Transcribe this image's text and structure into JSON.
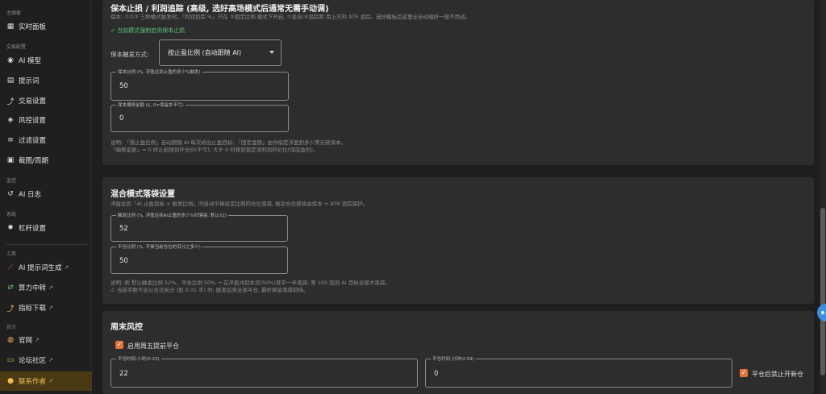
{
  "sidebar": {
    "sections": [
      {
        "label": "主面板"
      },
      {
        "label": "交易配置"
      },
      {
        "label": "监控"
      },
      {
        "label": "系统"
      },
      {
        "label": "工具"
      },
      {
        "label": "官方"
      }
    ],
    "items": [
      {
        "label": "实时面板",
        "icon": "dashboard-icon",
        "glyph": "▦"
      },
      {
        "label": "AI 模型",
        "icon": "brain-icon",
        "glyph": "◉"
      },
      {
        "label": "提示词",
        "icon": "document-icon",
        "glyph": "▤"
      },
      {
        "label": "交易设置",
        "icon": "chart-line-icon",
        "glyph": "⤴"
      },
      {
        "label": "风控设置",
        "icon": "shield-icon",
        "glyph": "◈"
      },
      {
        "label": "过滤设置",
        "icon": "filter-icon",
        "glyph": "≡"
      },
      {
        "label": "截图/周期",
        "icon": "image-icon",
        "glyph": "▣"
      },
      {
        "label": "AI 日志",
        "icon": "history-icon",
        "glyph": "↺"
      },
      {
        "label": "杠杆设置",
        "icon": "gear-icon",
        "glyph": "✹"
      },
      {
        "label": "AI 提示词生成",
        "icon": "magic-wand-icon",
        "glyph": "⟋",
        "external": "↗"
      },
      {
        "label": "算力中转",
        "icon": "exchange-icon",
        "glyph": "⇄",
        "external": "↗"
      },
      {
        "label": "指标下载",
        "icon": "trend-icon",
        "glyph": "⤴",
        "external": "↗"
      },
      {
        "label": "官网",
        "icon": "globe-icon",
        "glyph": "◍",
        "external": "↗"
      },
      {
        "label": "论坛社区",
        "icon": "chat-icon",
        "glyph": "▭",
        "external": "↗"
      },
      {
        "label": "联系作者",
        "icon": "user-icon",
        "glyph": "●",
        "external": "↗"
      }
    ]
  },
  "stoploss": {
    "title": "保本止损 / 利润追踪 (高级, 选好高场模式后通常无需手动调)",
    "desc": "保本: ①②③ 三种模式触发时。「利润追踪 %」只在 ②固定比例 模式下开启; ②混合/③追踪距 用上方的 ATR 追踪。选好模板后这里全自动编好一般不用动。",
    "notice": "✓ 当前模式强制启用保本止损",
    "trigger_label": "保本触发方式:",
    "trigger_value": "按止盈比例 (自动跟随 AI)",
    "ratio_label": "保本比例 (%, 浮盈达到止盈的多少%触发)",
    "ratio_value": "50",
    "offset_label": "保本偏移金额 ($, 0=保留本不亏)",
    "offset_value": "0",
    "note1": "说明: 「按止盈比例」自动跟随 AI 每次给出止盈目标; 「固定金额」由你指定浮盈到多少美元就保本。",
    "note2": "「偏移金额」= 0 时止损移到开仓价(不亏); 大于 0 时移到锁定该利润的价位(保底盈利)。"
  },
  "mixed": {
    "title": "混合模式落袋设置",
    "desc": "浮盈达到「AI 止盈目标 × 触发比例」时自动平掉设定比例的仓位落袋, 剩余仓位继续由保本 + ATR 追踪保护。",
    "trigger_label": "触发比例 (%, 浮盈达到AI止盈的多少%时落袋, 默认52)",
    "trigger_value": "52",
    "close_label": "平仓比例 (%, 平掉当前仓位的百分之多少)",
    "close_value": "50",
    "note1": "说明: 例 默认触发比例 52%、平仓比例 50% → 在浮盈冲到本点(50%)就平一半落袋; 第 100 回到 AI 目标全部才落袋。",
    "note2": "⚠ 当前手数不足以合法拆分 (如 0.01 手) 时, 触发后将全部平仓, 最终剩留落袋前持。"
  },
  "weekend": {
    "title": "周末风控",
    "enable_label": "启用周五提前平仓",
    "hour_label": "平仓时间-小时(0-23)",
    "hour_value": "22",
    "minute_label": "平仓时间-分钟(0-59)",
    "minute_value": "0",
    "forbid_label": "平仓后禁止开新仓"
  },
  "colors": {
    "accent": "#e0763a",
    "active_bg": "#4a3a14",
    "active_fg": "#f0c04a",
    "success": "#5ec27a"
  }
}
